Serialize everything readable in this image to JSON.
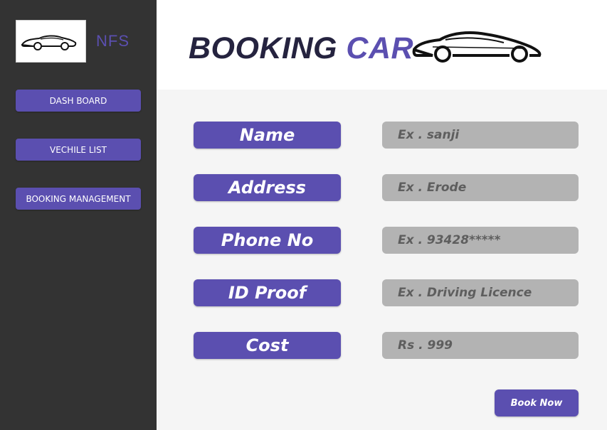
{
  "brand": {
    "name": "NFS"
  },
  "sidebar": {
    "items": [
      {
        "label": "DASH BOARD"
      },
      {
        "label": "VECHILE LIST"
      },
      {
        "label": "BOOKING MANAGEMENT"
      }
    ]
  },
  "header": {
    "title_part1": "BOOKING",
    "title_part2": "CAR"
  },
  "form": {
    "fields": [
      {
        "label": "Name",
        "placeholder": "Ex . sanji"
      },
      {
        "label": "Address",
        "placeholder": "Ex . Erode"
      },
      {
        "label": "Phone No",
        "placeholder": "Ex . 93428*****"
      },
      {
        "label": "ID Proof",
        "placeholder": "Ex . Driving Licence"
      },
      {
        "label": "Cost",
        "placeholder": "Rs . 999"
      }
    ],
    "submit_label": "Book Now"
  },
  "colors": {
    "accent": "#5b4fb0",
    "sidebar_bg": "#333333",
    "title_dark": "#25233f",
    "input_bg": "#b3b3b3"
  },
  "icons": {
    "logo": "car-silhouette-icon",
    "header": "car-silhouette-icon"
  }
}
